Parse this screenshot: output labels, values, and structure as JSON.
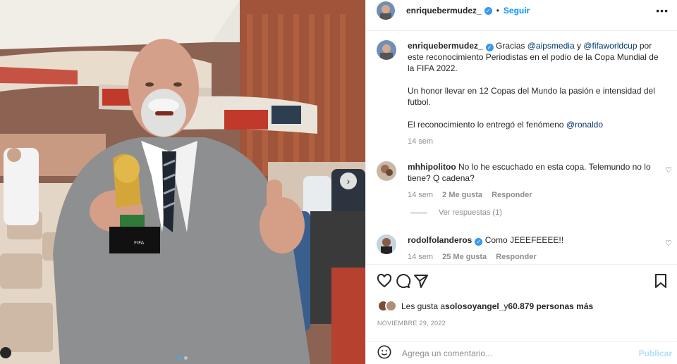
{
  "header": {
    "username": "enriquebermudez_",
    "separator": "•",
    "follow_label": "Seguir",
    "more_icon": "more-horizontal-icon"
  },
  "caption": {
    "username": "enriquebermudez_",
    "text_1": "Gracias ",
    "mention_1": "@aipsmedia",
    "text_2": " y ",
    "mention_2": "@fifaworldcup",
    "text_3": " por este reconocimiento Periodistas en el podio de la Copa Mundial de la FIFA 2022.",
    "para_2": "Un honor llevar en 12 Copas del Mundo la pasión e intensidad del futbol.",
    "para_3_text": "El reconocimiento lo entregó el fenómeno ",
    "para_3_mention": "@ronaldo",
    "time": "14 sem"
  },
  "comments": [
    {
      "username": "mhhipolitoo",
      "text": "No lo he escuchado en esta copa. Telemundo no lo tiene? Q cadena?",
      "time": "14 sem",
      "likes": "2 Me gusta",
      "reply": "Responder",
      "view_replies": "Ver respuestas (1)"
    },
    {
      "username": "rodolfolanderos",
      "text": "Como JEEEFEEEE!!",
      "time": "14 sem",
      "likes": "25 Me gusta",
      "reply": "Responder"
    }
  ],
  "actions": {
    "like_icon": "heart-icon",
    "comment_icon": "comment-icon",
    "share_icon": "send-icon",
    "save_icon": "bookmark-icon"
  },
  "likes": {
    "prefix": "Les gusta a ",
    "user": "solosoyangel_",
    "middle": " y ",
    "count": "60.879 personas más"
  },
  "date": "NOVIEMBRE 29, 2022",
  "add_comment": {
    "placeholder": "Agrega un comentario...",
    "publish_label": "Publicar",
    "emoji_icon": "smiley-icon"
  },
  "photo": {
    "carousel_total": 2,
    "carousel_active": 1,
    "next_icon": "chevron-right-icon"
  },
  "colors": {
    "accent": "#0095f6",
    "verified": "#3897f0",
    "mention": "#00376b",
    "muted": "#8e8e8e",
    "publish_disabled": "#b2dffc"
  }
}
